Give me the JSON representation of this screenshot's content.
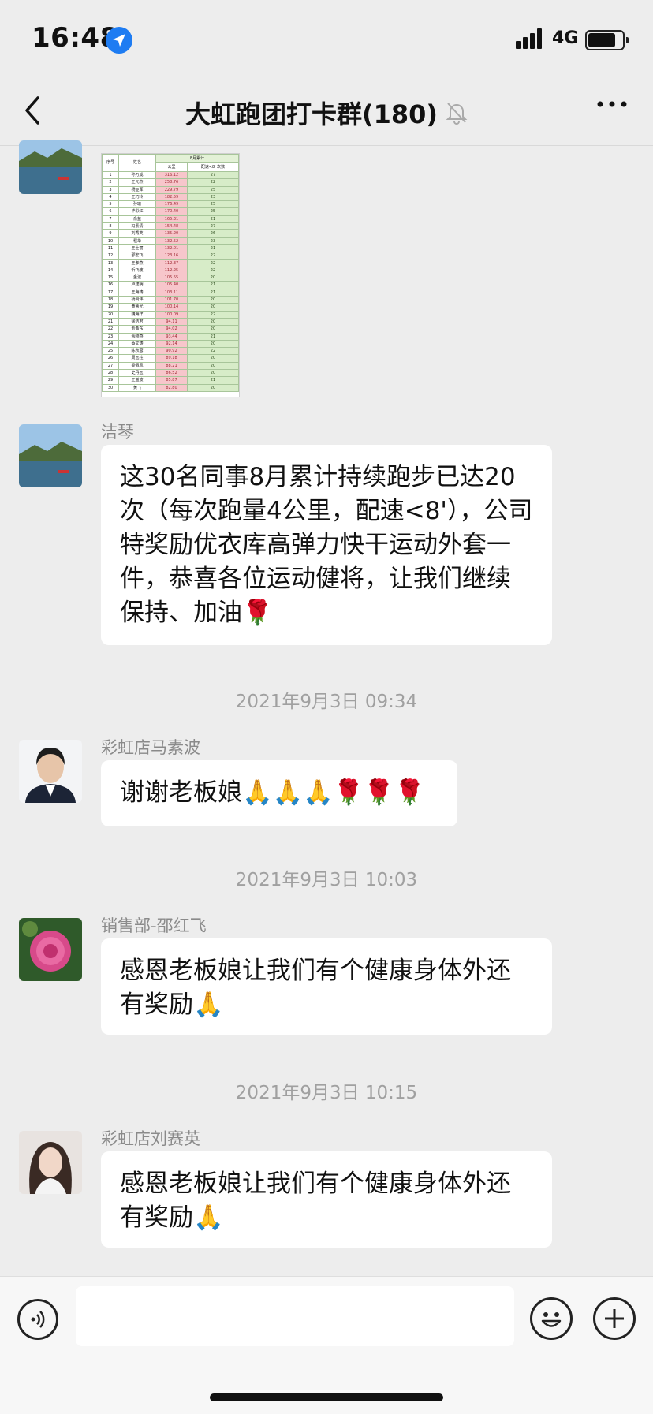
{
  "status": {
    "time": "16:48",
    "network": "4G"
  },
  "nav": {
    "title": "大虹跑团打卡群(180)"
  },
  "sheet": {
    "header_count": "数量",
    "header_month": "8月累计",
    "header_seq": "序号",
    "header_name": "姓名",
    "header_km": "公里",
    "header_times": "配速<8' 次数",
    "rows": [
      [
        "1",
        "孙万成",
        "316.12",
        "27"
      ],
      [
        "2",
        "王元杰",
        "258.76",
        "22"
      ],
      [
        "3",
        "杨亚军",
        "229.79",
        "25"
      ],
      [
        "4",
        "王巧玲",
        "182.59",
        "23"
      ],
      [
        "5",
        "孙瑜",
        "176.49",
        "25"
      ],
      [
        "6",
        "毕彩红",
        "170.40",
        "25"
      ],
      [
        "7",
        "俞益",
        "165.31",
        "21"
      ],
      [
        "8",
        "冯素清",
        "154.48",
        "27"
      ],
      [
        "9",
        "刘秀英",
        "135.20",
        "26"
      ],
      [
        "10",
        "程华",
        "132.52",
        "23"
      ],
      [
        "11",
        "王士丽",
        "132.01",
        "21"
      ],
      [
        "12",
        "邵宏飞",
        "123.16",
        "22"
      ],
      [
        "13",
        "王孝燕",
        "112.37",
        "22"
      ],
      [
        "14",
        "忻飞波",
        "112.25",
        "22"
      ],
      [
        "15",
        "金波",
        "105.55",
        "20"
      ],
      [
        "16",
        "卢建明",
        "105.40",
        "21"
      ],
      [
        "17",
        "王海涛",
        "103.11",
        "21"
      ],
      [
        "18",
        "杨贤伟",
        "101.70",
        "20"
      ],
      [
        "19",
        "黄鲁光",
        "100.14",
        "20"
      ],
      [
        "20",
        "魏海洋",
        "100.09",
        "22"
      ],
      [
        "21",
        "徐洁君",
        "94.11",
        "20"
      ],
      [
        "22",
        "俞备东",
        "94.02",
        "20"
      ],
      [
        "23",
        "余晓燕",
        "93.44",
        "21"
      ],
      [
        "24",
        "蔡文涛",
        "92.14",
        "20"
      ],
      [
        "25",
        "陈秋蓉",
        "90.92",
        "22"
      ],
      [
        "26",
        "周玉柱",
        "89.18",
        "20"
      ],
      [
        "27",
        "梁佩风",
        "88.21",
        "20"
      ],
      [
        "28",
        "史丹玉",
        "86.52",
        "20"
      ],
      [
        "29",
        "王益波",
        "85.87",
        "21"
      ],
      [
        "30",
        "黄飞",
        "82.80",
        "20"
      ]
    ]
  },
  "messages": [
    {
      "sender": "洁琴",
      "text": "这30名同事8月累计持续跑步已达20次（每次跑量4公里，配速<8'），公司特奖励优衣库高弹力快干运动外套一件，恭喜各位运动健将，让我们继续保持、加油🌹"
    },
    {
      "sender": "彩虹店马素波",
      "text": "谢谢老板娘🙏🙏🙏🌹🌹🌹"
    },
    {
      "sender": "销售部-邵红飞",
      "text": "感恩老板娘让我们有个健康身体外还有奖励🙏"
    },
    {
      "sender": "彩虹店刘赛英",
      "text": "感恩老板娘让我们有个健康身体外还有奖励🙏"
    }
  ],
  "timestamps": [
    "2021年9月3日 09:34",
    "2021年9月3日 10:03",
    "2021年9月3日 10:15"
  ]
}
